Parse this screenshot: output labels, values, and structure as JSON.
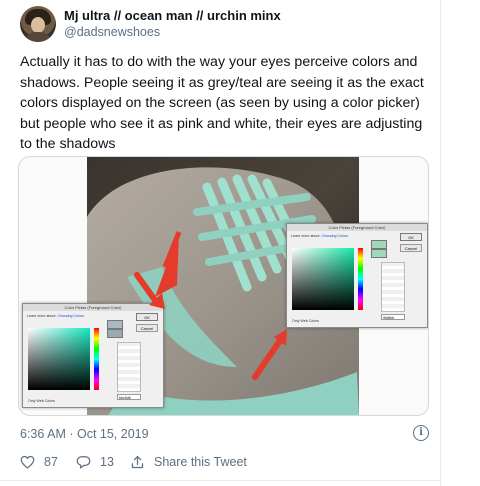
{
  "tweet": {
    "author_name": "Mj ultra // ocean man // urchin minx",
    "author_handle": "@dadsnewshoes",
    "text": "Actually it has to do with the way your eyes perceive colors and shadows. People seeing it as grey/teal are seeing it as the exact colors displayed on the screen (as seen by using a color picker) but people who see it as pink and white, their eyes are adjusting to the shadows",
    "timestamp": "6:36 AM · Oct 15, 2019"
  },
  "actions": {
    "likes_count": "87",
    "replies_count": "13",
    "share_label": "Share this Tweet"
  },
  "icons": {
    "like": "heart-icon",
    "reply": "reply-icon",
    "share": "share-icon",
    "info": "info-icon"
  },
  "media": {
    "picker_title": "Color Picker (Foreground Color)",
    "picker_ok": "OK",
    "picker_cancel": "Cancel",
    "picker_learn_more_prefix": "Learn more about:",
    "picker_learn_more_link": "Choosing Colors",
    "picker_new_label": "new",
    "picker_current_label": "current",
    "picker_web_colors": "Only Web Colors",
    "picker_left_hex": "bbc5db",
    "picker_right_hex": "9fd8bb"
  },
  "colors": {
    "text_primary": "#0f1419",
    "text_secondary": "#5b7083",
    "divider": "#e6ecf0",
    "arrow_red": "#e53b2a",
    "shoe_teal": "#8fd0c0",
    "shoe_grey": "#a19c93"
  }
}
